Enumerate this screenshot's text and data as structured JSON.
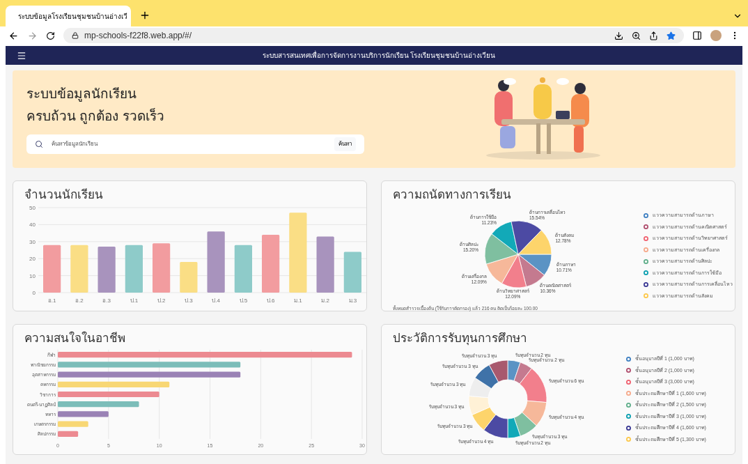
{
  "browser": {
    "tab_title": "ระบบข้อมูลโรงเรียนชุมชนบ้านอ่างเวี",
    "url": "mp-schools-f22f8.web.app/#/"
  },
  "header": {
    "title": "ระบบสารสนเทศเพื่อการจัดการงานบริการนักเรียน โรงเรียนชุมชนบ้านอ่างเวียน"
  },
  "hero": {
    "headline": [
      "ระบบข้อมูลนักเรียน",
      "ครบถ้วน ถูกต้อง รวดเร็ว"
    ],
    "search": {
      "placeholder": "ค้นหาข้อมูลนักเรียน",
      "button": "ค้นหา"
    }
  },
  "student_count": {
    "title": "จำนวนนักเรียน",
    "chart_data": {
      "type": "bar",
      "categories": [
        "อ.1",
        "อ.2",
        "อ.3",
        "ป.1",
        "ป.2",
        "ป.3",
        "ป.4",
        "ป.5",
        "ป.6",
        "ม.1",
        "ม.2",
        "ม.3"
      ],
      "values": [
        28,
        28,
        27,
        28,
        29,
        18,
        36,
        28,
        34,
        47,
        33,
        24
      ],
      "colors": [
        "#f29c9f",
        "#fade85",
        "#a893bd",
        "#8ecbc9",
        "#f29c9f",
        "#fade85",
        "#a893bd",
        "#8ecbc9",
        "#f29c9f",
        "#fade85",
        "#a893bd",
        "#8ecbc9"
      ],
      "ylim": [
        0,
        50
      ],
      "yticks": [
        0,
        10,
        20,
        30,
        40,
        50
      ],
      "grid": true
    }
  },
  "aptitude": {
    "title": "ความถนัดทางการเรียน",
    "chart_data": {
      "type": "pie",
      "categories": [
        "ด้านภาษา",
        "ด้านคณิตศาสตร์",
        "ด้านวิทยาศาสตร์",
        "ด้านเครื่องกล",
        "ด้านศิลปะ",
        "ด้านการใช้มือ",
        "ด้านการเคลื่อนไหว",
        "ด้านสังคม"
      ],
      "values": [
        10.71,
        10.36,
        12.09,
        12.09,
        15.2,
        11.23,
        15.54,
        12.78
      ],
      "value_labels": [
        "10.71%",
        "10.36%",
        "12.09%",
        "12.09%",
        "15.20%",
        "11.23%",
        "15.54%",
        "12.78%"
      ],
      "colors": [
        "#5b93c4",
        "#c47a8f",
        "#f27f8c",
        "#f6b89a",
        "#7fbfa0",
        "#12a9b8",
        "#4c4aa3",
        "#fdd46b"
      ]
    },
    "legend": [
      {
        "label": "แววความสามารถด้านภาษา",
        "color": "#3d7fc1"
      },
      {
        "label": "แววความสามารถด้านคณิตศาสตร์",
        "color": "#b04e6e"
      },
      {
        "label": "แววความสามารถด้านวิทยาศาสตร์",
        "color": "#f0606f"
      },
      {
        "label": "แววความสามารถด้านเครื่องกล",
        "color": "#f6a98a"
      },
      {
        "label": "แววความสามารถด้านศิลปะ",
        "color": "#5fae8a"
      },
      {
        "label": "แววความสามารถด้านการใช้มือ",
        "color": "#0a9fb0"
      },
      {
        "label": "แววความสามารถด้านการเคลื่อนไหว",
        "color": "#3a3894"
      },
      {
        "label": "แววความสามารถด้านสังคม",
        "color": "#fcc84a"
      }
    ],
    "footnote": "ทั้งหมดสำรวจเบื้องต้น (ใช้รับการคัดกรอง) แล้ว 216 คน คิดเป็นร้อยละ 100.00"
  },
  "career_interest": {
    "title": "ความสนใจในอาชีพ",
    "chart_data": {
      "type": "bar",
      "orientation": "horizontal",
      "categories": [
        "กีฬา",
        "พาณิชยกรรม",
        "อุตสาหกรรม",
        "คหกรรม",
        "วิชาการ",
        "ดนตรี-นาฏศิลป์",
        "ทหาร",
        "เกษตรกรรม",
        "ศิลปกรรม"
      ],
      "values": [
        29,
        18,
        18,
        11,
        10,
        8,
        5,
        3,
        2
      ],
      "colors": [
        "#ec8a91",
        "#7cbdb9",
        "#9a82b5",
        "#f8d774",
        "#ec8a91",
        "#7cbdb9",
        "#9a82b5",
        "#f8d774",
        "#ec8a91"
      ],
      "xlim": [
        0,
        30
      ],
      "xticks": [
        0,
        5,
        10,
        15,
        20,
        25,
        30
      ],
      "grid": true
    }
  },
  "scholarship_history": {
    "title": "ประวัติการรับทุนการศึกษา",
    "chart_data": {
      "type": "donut",
      "values": [
        2,
        2,
        6,
        4,
        3,
        2,
        4,
        3,
        3,
        3,
        3,
        3
      ],
      "value_labels": [
        "รับทุนจำนวน 2 ทุน",
        "รับทุนจำนวน 2 ทุน",
        "รับทุนจำนวน 6 ทุน",
        "รับทุนจำนวน 4 ทุน",
        "รับทุนจำนวน 3 ทุน",
        "รับทุนจำนวน 2 ทุน",
        "รับทุนจำนวน 4 ทุน",
        "รับทุนจำนวน 3 ทุน",
        "รับทุนจำนวน 3 ทุน",
        "รับทุนจำนวน 3 ทุน",
        "รับทุนจำนวน 3 ทุน",
        "รับทุนจำนวน 3 ทุน"
      ],
      "colors": [
        "#5b93c4",
        "#c47a8f",
        "#f27f8c",
        "#f6b89a",
        "#7fbfa0",
        "#12a9b8",
        "#4c4aa3",
        "#fdd46b",
        "#fff1d6",
        "#eeeeee",
        "#3f72a8",
        "#a8596e"
      ]
    },
    "legend": [
      {
        "label": "ชั้นอนุบาลปีที่ 1 (1,000 บาท)",
        "color": "#3d7fc1"
      },
      {
        "label": "ชั้นอนุบาลปีที่ 2 (1,000 บาท)",
        "color": "#b04e6e"
      },
      {
        "label": "ชั้นอนุบาลปีที่ 3 (3,000 บาท)",
        "color": "#f0606f"
      },
      {
        "label": "ชั้นประถมศึกษาปีที่ 1 (1,600 บาท)",
        "color": "#f6a98a"
      },
      {
        "label": "ชั้นประถมศึกษาปีที่ 2 (1,500 บาท)",
        "color": "#5fae8a"
      },
      {
        "label": "ชั้นประถมศึกษาปีที่ 3 (1,000 บาท)",
        "color": "#0a9fb0"
      },
      {
        "label": "ชั้นประถมศึกษาปีที่ 4 (1,600 บาท)",
        "color": "#3a3894"
      },
      {
        "label": "ชั้นประถมศึกษาปีที่ 5 (1,300 บาท)",
        "color": "#fcc84a"
      }
    ]
  }
}
